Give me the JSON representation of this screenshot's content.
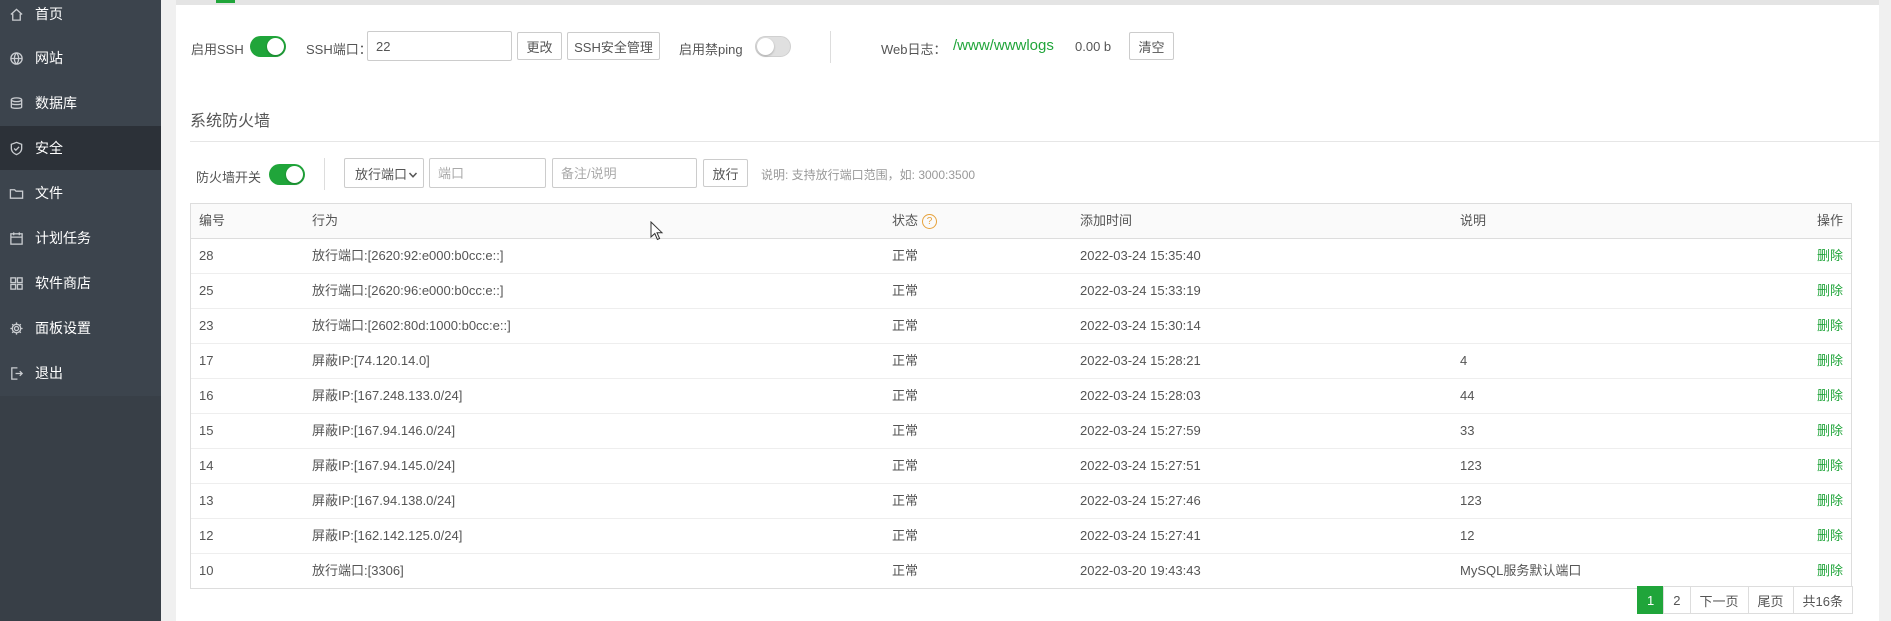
{
  "sidebar": {
    "items": [
      {
        "label": "首页",
        "icon": "home-icon",
        "active": false
      },
      {
        "label": "网站",
        "icon": "globe-icon",
        "active": false
      },
      {
        "label": "数据库",
        "icon": "database-icon",
        "active": false
      },
      {
        "label": "安全",
        "icon": "shield-icon",
        "active": true
      },
      {
        "label": "文件",
        "icon": "folder-icon",
        "active": false
      },
      {
        "label": "计划任务",
        "icon": "calendar-icon",
        "active": false
      },
      {
        "label": "软件商店",
        "icon": "grid-icon",
        "active": false
      },
      {
        "label": "面板设置",
        "icon": "gear-icon",
        "active": false
      },
      {
        "label": "退出",
        "icon": "logout-icon",
        "active": false
      }
    ]
  },
  "ssh": {
    "enable_label": "启用SSH",
    "enabled": true,
    "port_label": "SSH端口：",
    "port_value": "22",
    "change_button": "更改",
    "manage_button": "SSH安全管理",
    "ping_label": "启用禁ping",
    "ping_enabled": false,
    "weblog_label": "Web日志：",
    "weblog_path": "/www/wwwlogs",
    "weblog_size": "0.00 b",
    "clear_button": "清空"
  },
  "firewall": {
    "title": "系统防火墙",
    "switch_label": "防火墙开关",
    "enabled": true,
    "mode_select": "放行端口",
    "port_placeholder": "端口",
    "note_placeholder": "备注/说明",
    "allow_button": "放行",
    "hint": "说明: 支持放行端口范围，如: 3000:3500"
  },
  "table": {
    "headers": [
      "编号",
      "行为",
      "状态",
      "添加时间",
      "说明",
      "操作"
    ],
    "status_help": "?",
    "rows": [
      {
        "id": "28",
        "action": "放行端口:[2620:92:e000:b0cc:e::]",
        "status": "正常",
        "time": "2022-03-24 15:35:40",
        "note": "",
        "op": "删除"
      },
      {
        "id": "25",
        "action": "放行端口:[2620:96:e000:b0cc:e::]",
        "status": "正常",
        "time": "2022-03-24 15:33:19",
        "note": "",
        "op": "删除"
      },
      {
        "id": "23",
        "action": "放行端口:[2602:80d:1000:b0cc:e::]",
        "status": "正常",
        "time": "2022-03-24 15:30:14",
        "note": "",
        "op": "删除"
      },
      {
        "id": "17",
        "action": "屏蔽IP:[74.120.14.0]",
        "status": "正常",
        "time": "2022-03-24 15:28:21",
        "note": "4",
        "op": "删除"
      },
      {
        "id": "16",
        "action": "屏蔽IP:[167.248.133.0/24]",
        "status": "正常",
        "time": "2022-03-24 15:28:03",
        "note": "44",
        "op": "删除"
      },
      {
        "id": "15",
        "action": "屏蔽IP:[167.94.146.0/24]",
        "status": "正常",
        "time": "2022-03-24 15:27:59",
        "note": "33",
        "op": "删除"
      },
      {
        "id": "14",
        "action": "屏蔽IP:[167.94.145.0/24]",
        "status": "正常",
        "time": "2022-03-24 15:27:51",
        "note": "123",
        "op": "删除"
      },
      {
        "id": "13",
        "action": "屏蔽IP:[167.94.138.0/24]",
        "status": "正常",
        "time": "2022-03-24 15:27:46",
        "note": "123",
        "op": "删除"
      },
      {
        "id": "12",
        "action": "屏蔽IP:[162.142.125.0/24]",
        "status": "正常",
        "time": "2022-03-24 15:27:41",
        "note": "12",
        "op": "删除"
      },
      {
        "id": "10",
        "action": "放行端口:[3306]",
        "status": "正常",
        "time": "2022-03-20 19:43:43",
        "note": "MySQL服务默认端口",
        "op": "删除"
      }
    ]
  },
  "pagination": {
    "pages": [
      "1",
      "2"
    ],
    "current": "1",
    "next": "下一页",
    "last": "尾页",
    "total": "共16条"
  },
  "colors": {
    "accent": "#20a53a",
    "sidebar": "#3c444d",
    "sidebar_active": "#2c3138",
    "help": "#e6a23c"
  }
}
